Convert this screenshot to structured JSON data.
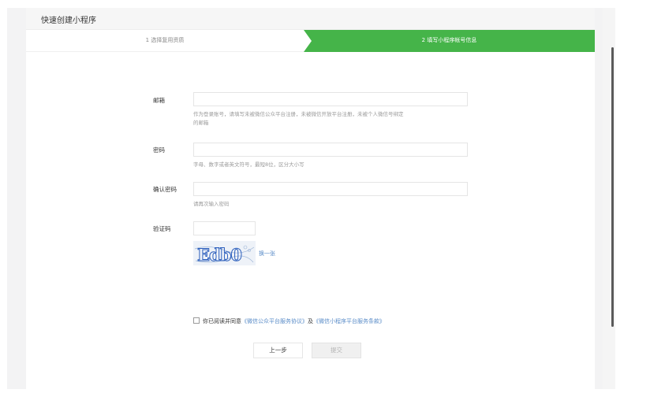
{
  "header": {
    "title": "快速创建小程序"
  },
  "steps": [
    {
      "label": "1 选择复用资质",
      "active": false
    },
    {
      "label": "2 填写小程序帐号信息",
      "active": true
    }
  ],
  "form": {
    "email": {
      "label": "邮箱",
      "value": "",
      "hint_line1": "作为登录账号，请填写未被微信公众平台注册，未被微信开放平台注册，未被个人微信号绑定",
      "hint_line2": "的邮箱"
    },
    "password": {
      "label": "密码",
      "value": "",
      "hint": "字母、数字或者英文符号，最短8位，区分大小写"
    },
    "confirm_password": {
      "label": "确认密码",
      "value": "",
      "hint": "请再次输入密码"
    },
    "captcha": {
      "label": "验证码",
      "value": "",
      "image_text": "Edb0",
      "refresh_label": "换一张"
    }
  },
  "agreement": {
    "checked": false,
    "prefix": "你已阅读并同意",
    "link1": "《微信公众平台服务协议》",
    "conjunction": "及",
    "link2": "《微信小程序平台服务条款》"
  },
  "buttons": {
    "prev": "上一步",
    "submit": "提交"
  },
  "colors": {
    "active_step": "#45b449",
    "link": "#5a8cc8"
  }
}
